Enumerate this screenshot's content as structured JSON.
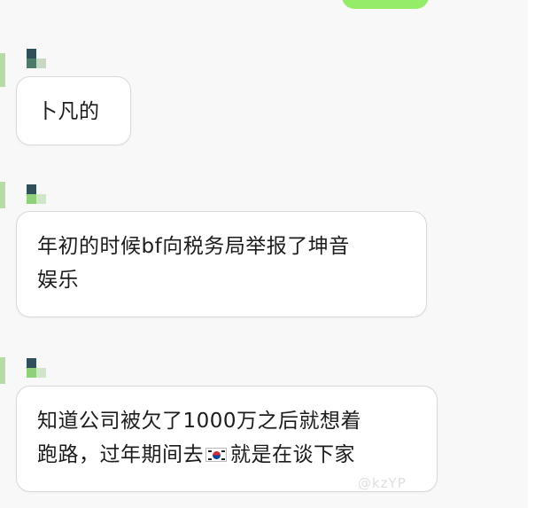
{
  "colors": {
    "chat_background": "#f8f8f8",
    "sent_bubble": "#95ec69",
    "received_bubble": "#ffffff",
    "avatar_dark": "#2f4f5a",
    "avatar_light": "#8fd07a"
  },
  "messages": [
    {
      "direction": "received",
      "lines": [
        "卜凡的"
      ]
    },
    {
      "direction": "received",
      "lines": [
        "年初的时候bf向税务局举报了坤音",
        "娱乐"
      ]
    },
    {
      "direction": "received",
      "lines": [
        "知道公司被欠了1000万之后就想着",
        "跑路，过年期间去",
        "就是在谈下家"
      ],
      "inline_icon": "south-korea-flag-icon"
    }
  ],
  "watermark": "@kzYP"
}
